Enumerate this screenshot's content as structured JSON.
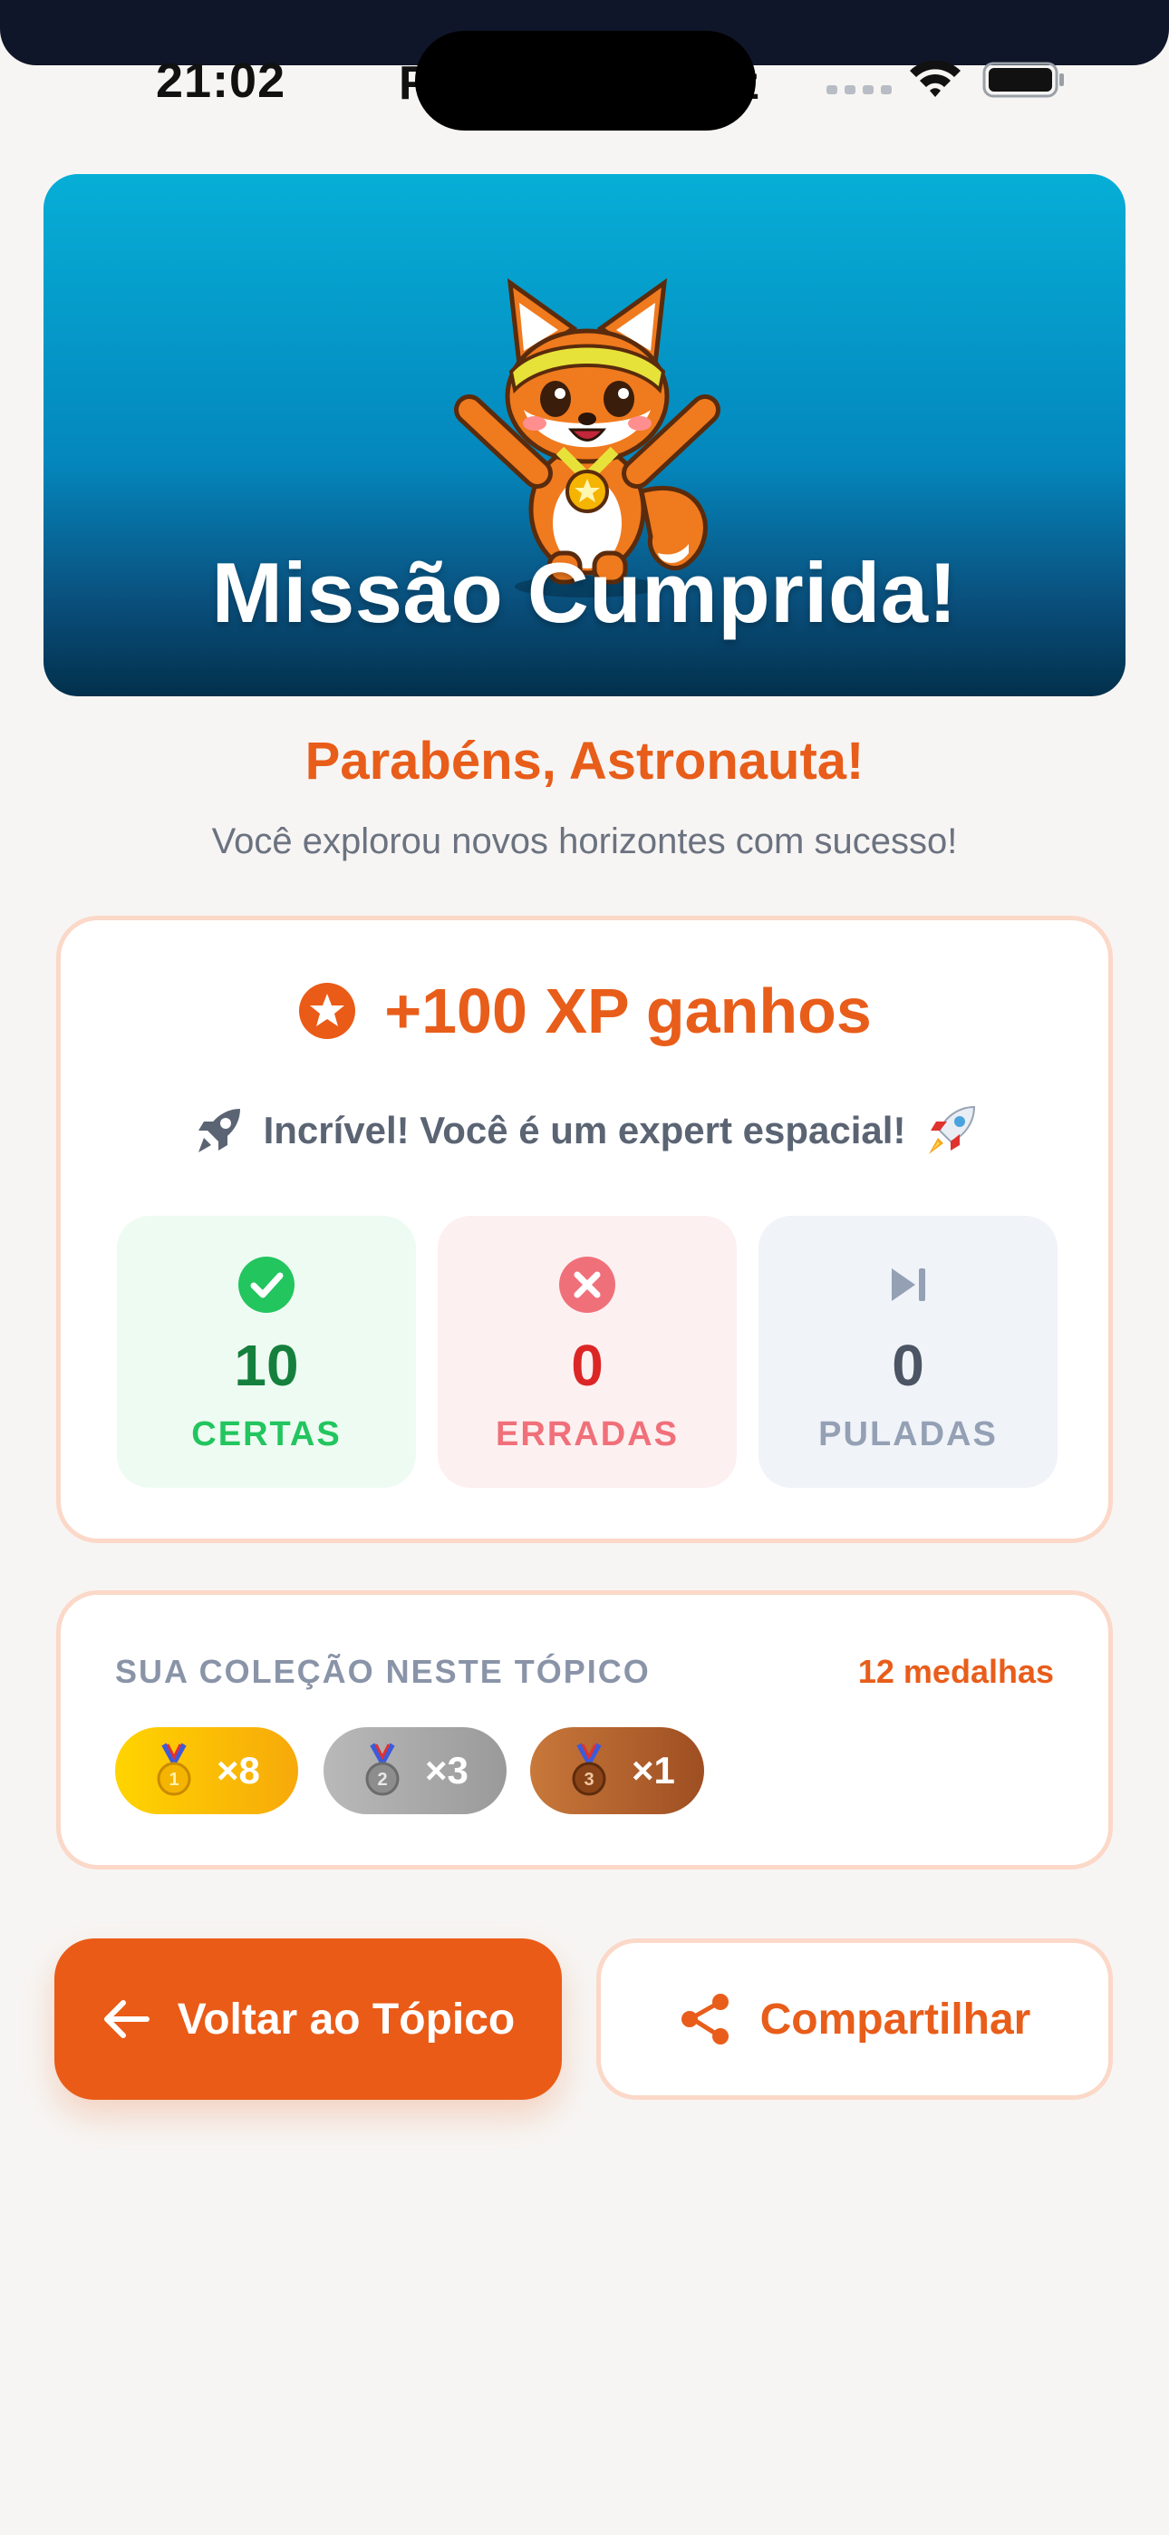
{
  "status_bar": {
    "time": "21:02",
    "behind_left": "F",
    "behind_right": "z"
  },
  "hero": {
    "title": "Missão Cumprida!",
    "mascot": "fox-mascot-with-medal"
  },
  "congrats": {
    "title": "Parabéns, Astronauta!",
    "subtitle": "Você explorou novos horizontes com sucesso!"
  },
  "xp": {
    "label": "+100 XP ganhos",
    "message": "Incrível! Você é um expert espacial!"
  },
  "stats": [
    {
      "value": "10",
      "label": "CERTAS",
      "icon": "check-circle-icon",
      "color": "#22c55e"
    },
    {
      "value": "0",
      "label": "ERRADAS",
      "icon": "x-circle-icon",
      "color": "#f0707a"
    },
    {
      "value": "0",
      "label": "PULADAS",
      "icon": "skip-next-icon",
      "color": "#94a0b4"
    }
  ],
  "collection": {
    "heading": "SUA COLEÇÃO NESTE TÓPICO",
    "total": "12 medalhas",
    "medals": [
      {
        "kind": "gold-medal-icon",
        "count": "×8"
      },
      {
        "kind": "silver-medal-icon",
        "count": "×3"
      },
      {
        "kind": "bronze-medal-icon",
        "count": "×1"
      }
    ]
  },
  "buttons": {
    "back": "Voltar ao Tópico",
    "share": "Compartilhar"
  },
  "colors": {
    "accent": "#ea5b17",
    "correct": "#22c55e",
    "wrong": "#ef4444",
    "skip": "#94a0b4"
  }
}
